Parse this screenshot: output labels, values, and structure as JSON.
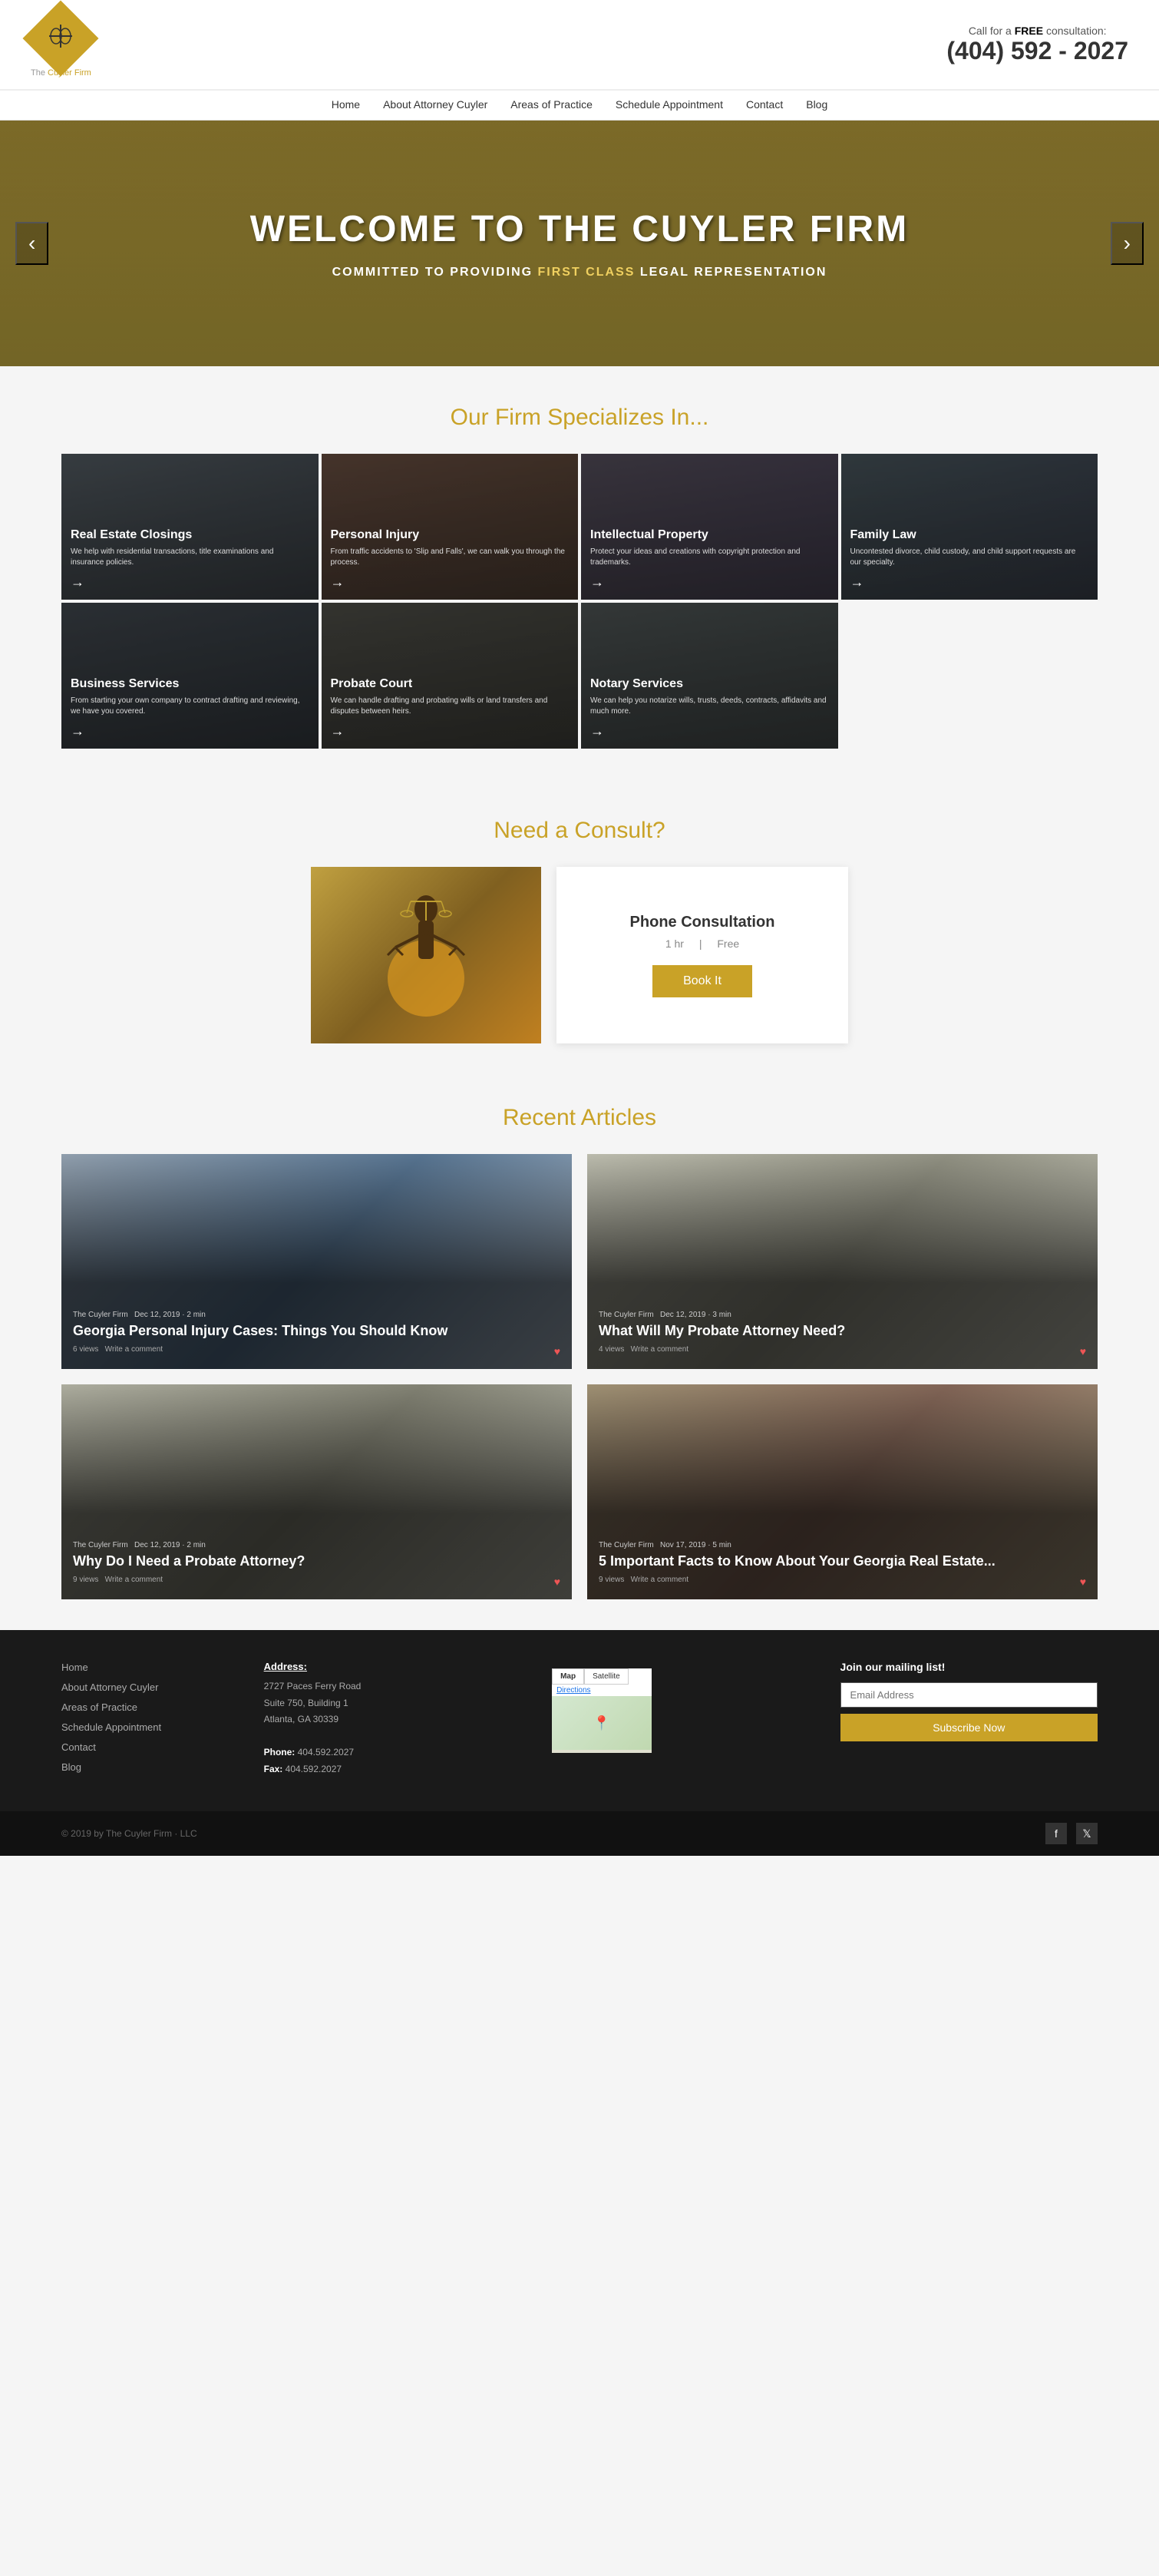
{
  "site": {
    "logo_text": "The Cuyler Firm, LLC",
    "logo_highlight": "Cuyler Firm",
    "call_text": "Call for a ",
    "call_free": "FREE",
    "call_suffix": " consultation:",
    "phone": "(404) 592 - 2027"
  },
  "nav": {
    "items": [
      "Home",
      "About Attorney Cuyler",
      "Areas of Practice",
      "Schedule Appointment",
      "Contact",
      "Blog"
    ]
  },
  "hero": {
    "title": "WELCOME TO THE CUYLER FIRM",
    "subtitle_prefix": "COMMITTED TO PROVIDING ",
    "subtitle_highlight": "FIRST CLASS",
    "subtitle_suffix": " LEGAL REPRESENTATION",
    "arrow_left": "‹",
    "arrow_right": "›"
  },
  "specializes": {
    "title": "Our Firm Specializes In...",
    "services": [
      {
        "id": "real-estate",
        "title": "Real Estate Closings",
        "desc": "We help with residential transactions, title examinations and insurance policies.",
        "icon": "🏠"
      },
      {
        "id": "personal-injury",
        "title": "Personal Injury",
        "desc": "From traffic accidents to 'Slip and Falls', we can walk you through the process.",
        "icon": "⚖️"
      },
      {
        "id": "intellectual",
        "title": "Intellectual Property",
        "desc": "Protect your ideas and creations with copyright protection and trademarks.",
        "icon": "💡"
      },
      {
        "id": "family-law",
        "title": "Family Law",
        "desc": "Uncontested divorce, child custody, and child support requests are our specialty.",
        "icon": "👨‍👩‍👧"
      },
      {
        "id": "business",
        "title": "Business Services",
        "desc": "From starting your own company to contract drafting and reviewing, we have you covered.",
        "icon": "💼"
      },
      {
        "id": "probate",
        "title": "Probate Court",
        "desc": "We can handle drafting and probating wills or land transfers and disputes between heirs.",
        "icon": "📜"
      },
      {
        "id": "notary",
        "title": "Notary Services",
        "desc": "We can help you notarize wills, trusts, deeds, contracts, affidavits and much more.",
        "icon": "✍️"
      }
    ]
  },
  "consult": {
    "title": "Need a Consult?",
    "card_title": "Phone Consultation",
    "duration": "1 hr",
    "price": "Free",
    "button": "Book It"
  },
  "articles": {
    "title": "Recent Articles",
    "items": [
      {
        "id": "art1",
        "source": "The Cuyler Firm",
        "date": "Dec 12, 2019 · 2 min",
        "title": "Georgia Personal Injury Cases: Things You Should Know",
        "views": "6 views",
        "write_comment": "Write a comment"
      },
      {
        "id": "art2",
        "source": "The Cuyler Firm",
        "date": "Dec 12, 2019 · 3 min",
        "title": "What Will My Probate Attorney Need?",
        "views": "4 views",
        "write_comment": "Write a comment"
      },
      {
        "id": "art3",
        "source": "The Cuyler Firm",
        "date": "Dec 12, 2019 · 2 min",
        "title": "Why Do I Need a Probate Attorney?",
        "views": "9 views",
        "write_comment": "Write a comment"
      },
      {
        "id": "art4",
        "source": "The Cuyler Firm",
        "date": "Nov 17, 2019 · 5 min",
        "title": "5 Important Facts to Know About Your Georgia Real Estate...",
        "views": "9 views",
        "write_comment": "Write a comment"
      }
    ]
  },
  "footer": {
    "links": [
      "Home",
      "About Attorney Cuyler",
      "Areas of Practice",
      "Schedule Appointment",
      "Contact",
      "Blog"
    ],
    "address_label": "Address:",
    "address_line1": "2727 Paces Ferry Road",
    "address_line2": "Suite 750, Building 1",
    "address_line3": "Atlanta, GA 30339",
    "phone_label": "Phone:",
    "phone_value": "404.592.2027",
    "fax_label": "Fax:",
    "fax_value": "404.592.2027",
    "map_tab1": "Map",
    "map_tab2": "Satellite",
    "map_directions": "Directions",
    "subscribe_title": "Join our mailing list!",
    "subscribe_placeholder": "Email Address",
    "subscribe_btn": "Subscribe Now",
    "copyright": "© 2019  by The Cuyler Firm · LLC"
  }
}
